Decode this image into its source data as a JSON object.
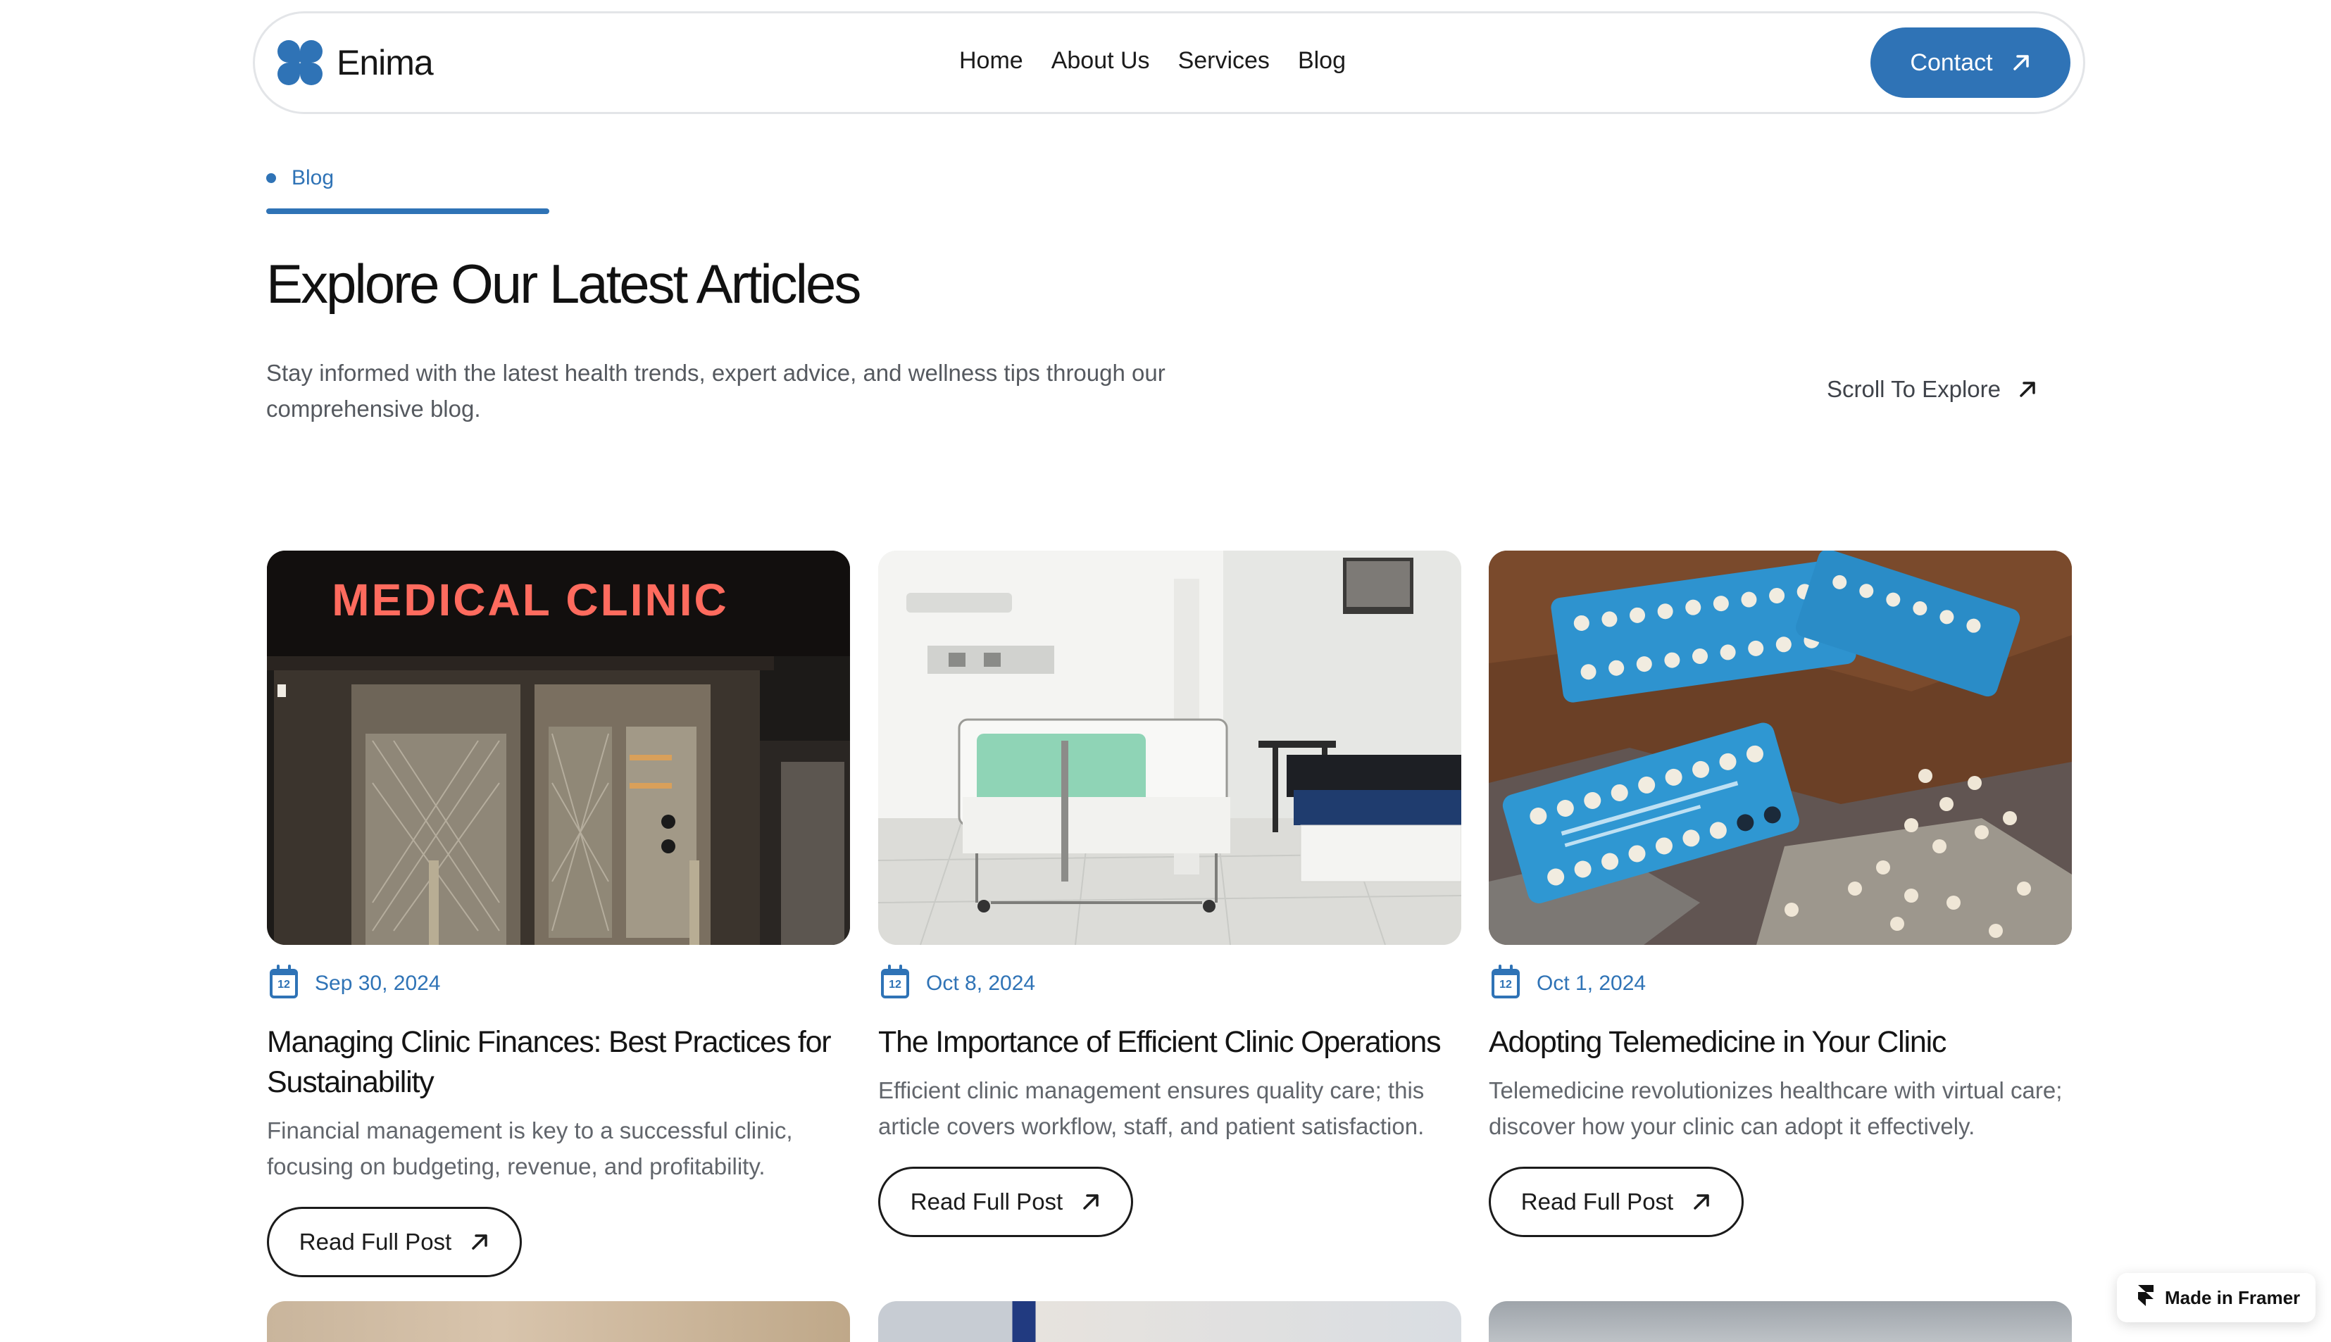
{
  "brand": {
    "name": "Enima",
    "accent": "#2f73b6"
  },
  "nav": {
    "items": [
      "Home",
      "About Us",
      "Services",
      "Blog"
    ],
    "contact_label": "Contact"
  },
  "hero": {
    "eyebrow": "Blog",
    "title": "Explore Our Latest Articles",
    "subtitle": "Stay informed with the latest health trends, expert advice, and wellness tips through our comprehensive blog.",
    "scroll_label": "Scroll To Explore"
  },
  "posts": [
    {
      "image": "medical-clinic-storefront",
      "sign_text": "MEDICAL CLINIC",
      "calendar_day": "12",
      "date": "Sep 30, 2024",
      "title": "Managing Clinic Finances: Best Practices for Sustainability",
      "excerpt": "Financial management is key to a successful clinic, focusing on budgeting, revenue, and profitability.",
      "cta": "Read Full Post"
    },
    {
      "image": "hospital-room-bed",
      "calendar_day": "12",
      "date": "Oct 8, 2024",
      "title": "The Importance of Efficient Clinic Operations",
      "excerpt": "Efficient clinic management ensures quality care; this article covers workflow, staff, and patient satisfaction.",
      "cta": "Read Full Post"
    },
    {
      "image": "blue-pill-blister-packs",
      "calendar_day": "12",
      "date": "Oct 1, 2024",
      "title": "Adopting Telemedicine in Your Clinic",
      "excerpt": "Telemedicine revolutionizes healthcare with virtual care; discover how your clinic can adopt it effectively.",
      "cta": "Read Full Post"
    }
  ],
  "badge": {
    "label": "Made in Framer"
  },
  "icons": [
    "logo-icon",
    "arrow-up-right-icon",
    "calendar-icon",
    "framer-icon"
  ]
}
